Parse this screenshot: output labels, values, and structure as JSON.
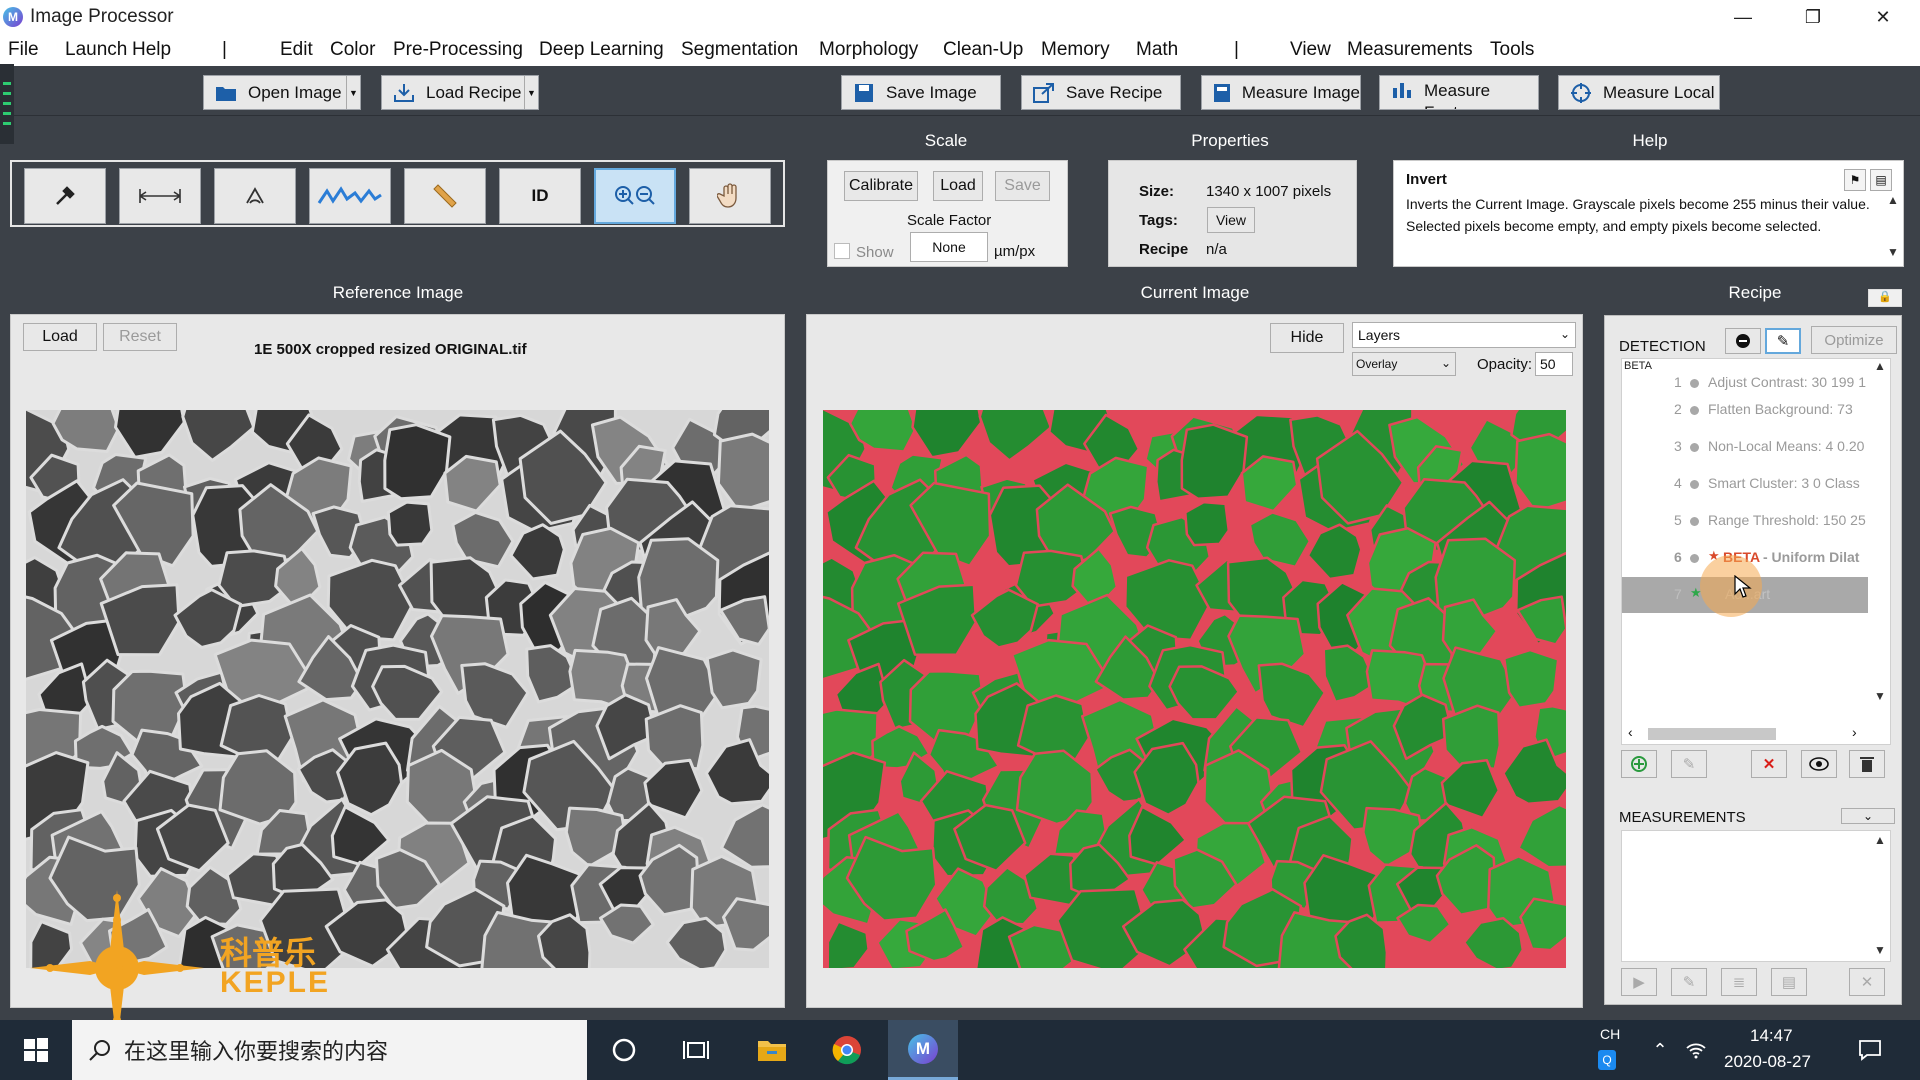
{
  "window": {
    "title": "Image Processor",
    "app_icon_letter": "M",
    "controls": [
      "—",
      "❐",
      "✕"
    ]
  },
  "menu": {
    "left": [
      "File",
      "Launch",
      "Help"
    ],
    "separator": "|",
    "center": [
      "Edit",
      "Color",
      "Pre-Processing",
      "Deep Learning",
      "Segmentation",
      "Morphology",
      "Clean-Up",
      "Memory",
      "Math"
    ],
    "right": [
      "View",
      "Measurements",
      "Tools"
    ]
  },
  "toolbar": {
    "open_image": "Open Image",
    "load_recipe": "Load Recipe",
    "save_image": "Save Image",
    "save_recipe": "Save Recipe",
    "measure_image": "Measure Image",
    "measure_features": "Measure Features",
    "measure_local": "Measure Local"
  },
  "tools": {
    "id_label": "ID",
    "active": "zoom"
  },
  "scale": {
    "heading": "Scale",
    "calibrate": "Calibrate",
    "load": "Load",
    "save": "Save",
    "factor_label": "Scale Factor",
    "show_label": "Show",
    "factor_value": "None",
    "unit": "µm/px"
  },
  "properties": {
    "heading": "Properties",
    "size_label": "Size:",
    "size_value": "1340 x 1007 pixels",
    "tags_label": "Tags:",
    "tags_button": "View",
    "recipe_label": "Recipe",
    "recipe_value": "n/a"
  },
  "help": {
    "heading": "Help",
    "title": "Invert",
    "text": "Inverts the Current Image. Grayscale pixels become 255 minus their value. Selected pixels become empty, and empty pixels become selected."
  },
  "reference": {
    "heading": "Reference Image",
    "load": "Load",
    "reset": "Reset",
    "filename": "1E 500X cropped resized ORIGINAL.tif"
  },
  "current": {
    "heading": "Current Image",
    "hide": "Hide",
    "layers_value": "Layers",
    "overlay_value": "Overlay",
    "opacity_label": "Opacity:",
    "opacity_value": "50"
  },
  "watermark": {
    "cn": "科普乐",
    "en": "KEPLE"
  },
  "recipe": {
    "heading": "Recipe",
    "detection_label": "DETECTION",
    "optimize": "Optimize",
    "beta_tag": "BETA",
    "steps": [
      {
        "num": "1",
        "text": "Adjust Contrast: 30 199 1"
      },
      {
        "num": "2",
        "text": "Flatten Background: 73"
      },
      {
        "num": "3",
        "text": "Non-Local Means: 4 0.20"
      },
      {
        "num": "4",
        "text": "Smart Cluster: 3 0 Class"
      },
      {
        "num": "5",
        "text": "Range Threshold: 150 25"
      },
      {
        "num": "6",
        "beta": "BETA",
        "text": " - Uniform Dilat"
      },
      {
        "num": "7",
        "text": "Ad...art"
      }
    ],
    "measurements_label": "MEASUREMENTS"
  },
  "taskbar": {
    "search_placeholder": "在这里输入你要搜索的内容",
    "lang": "CH",
    "time": "14:47",
    "date": "2020-08-27"
  },
  "colors": {
    "background": "#3c4148",
    "panel": "#f0f0f0",
    "accent_blue": "#64a8dc",
    "segment_green": "#2e9a3c",
    "boundary_red": "#e2485a",
    "watermark_orange": "#f2a422"
  }
}
